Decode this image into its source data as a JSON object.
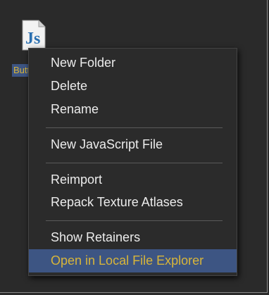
{
  "asset": {
    "icon": "javascript-file-icon",
    "icon_text": "Js",
    "label": "Button.js"
  },
  "context_menu": {
    "items": [
      {
        "label": "New Folder"
      },
      {
        "label": "Delete"
      },
      {
        "label": "Rename"
      },
      {
        "label": "New JavaScript File"
      },
      {
        "label": "Reimport"
      },
      {
        "label": "Repack Texture Atlases"
      },
      {
        "label": "Show Retainers"
      },
      {
        "label": "Open in Local File Explorer"
      }
    ],
    "highlighted_item": "Open in Local File Explorer"
  },
  "colors": {
    "background": "#2a2a2a",
    "menu_background": "#2b2b2b",
    "highlight": "#3d5583",
    "highlight_text": "#d8b53a",
    "text": "#ececec"
  }
}
